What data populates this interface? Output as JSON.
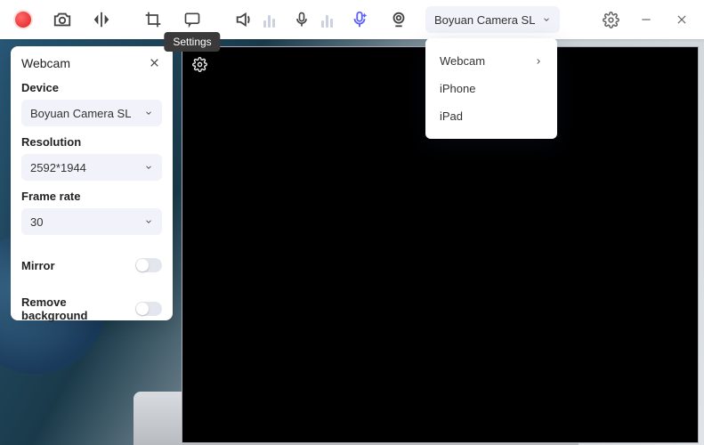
{
  "toolbar": {
    "tooltip_settings": "Settings",
    "camera_selected": "Boyuan Camera SL",
    "camera_menu": {
      "webcam": "Webcam",
      "iphone": "iPhone",
      "ipad": "iPad"
    }
  },
  "panel": {
    "title": "Webcam",
    "device_label": "Device",
    "device_value": "Boyuan Camera SL",
    "resolution_label": "Resolution",
    "resolution_value": "2592*1944",
    "frame_rate_label": "Frame rate",
    "frame_rate_value": "30",
    "mirror_label": "Mirror",
    "remove_bg_label": "Remove background"
  }
}
